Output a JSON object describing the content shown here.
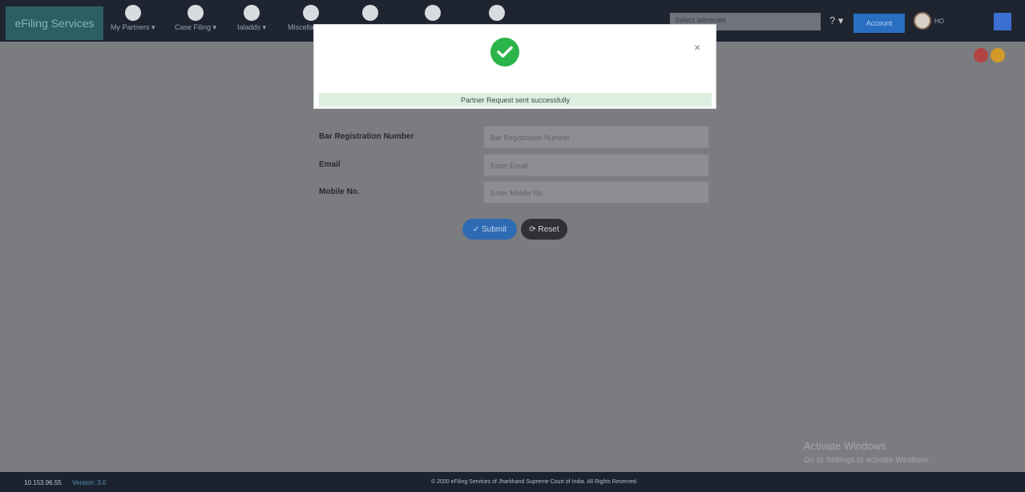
{
  "header": {
    "brand": "eFiling Services",
    "nav": [
      {
        "label": "My Partners ▾",
        "icon": "partners-icon"
      },
      {
        "label": "Case Filing ▾",
        "icon": "edit-icon"
      },
      {
        "label": "Ialadds ▾",
        "icon": "document-icon"
      },
      {
        "label": "Miscellaneous",
        "icon": "list-icon"
      },
      {
        "label": "",
        "icon": "rupee-icon"
      },
      {
        "label": "",
        "icon": "info-icon"
      },
      {
        "label": "",
        "icon": "report-icon"
      }
    ],
    "search_value": "Select advocate",
    "help": "? ▾",
    "action_button": "Account",
    "user_label": "HO",
    "corner_icon": "flag-icon"
  },
  "form": {
    "rows": [
      {
        "label": "Bar Registration Number",
        "placeholder": "Bar Registration Number"
      },
      {
        "label": "Email",
        "placeholder": "Enter Email"
      },
      {
        "label": "Mobile No.",
        "placeholder": "Enter Mobile No."
      }
    ],
    "submit": "✓ Submit",
    "reset": "⟳ Reset"
  },
  "modal": {
    "message": "Partner Request sent successfully",
    "close": "×"
  },
  "watermark": {
    "line1": "Activate Windows",
    "line2": "Go to Settings to activate Windows."
  },
  "footer": {
    "ip": "10.153.96.55",
    "version": "Version: 3.0",
    "copyright": "© 2020 eFiling Services of Jharkhand Supreme Court of India. All Rights Reserved."
  }
}
